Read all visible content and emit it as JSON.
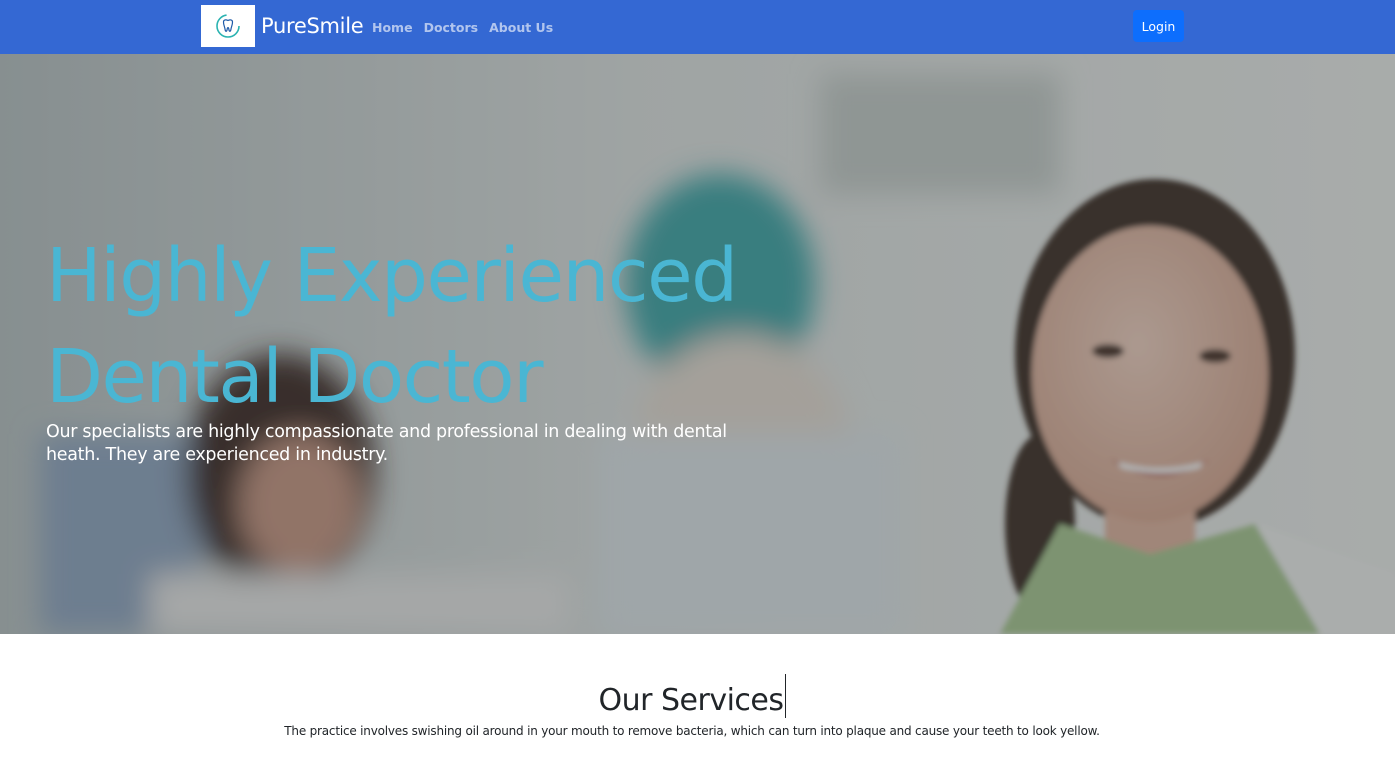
{
  "navbar": {
    "brand_name": "PureSmile",
    "logo_icon": "tooth-logo-icon",
    "links": [
      "Home",
      "Doctors",
      "About Us"
    ],
    "login_label": "Login",
    "background_color": "#3468d3",
    "login_color": "#0d6efd"
  },
  "hero": {
    "title": "Highly Experienced Dental Doctor",
    "subtitle": "Our specialists are highly compassionate and professional in dealing with dental heath. They are experienced in industry.",
    "title_color": "#4ab6d3"
  },
  "services": {
    "title": "Our Services",
    "description": "The practice involves swishing oil around in your mouth to remove bacteria, which can turn into plaque and cause your teeth to look yellow."
  }
}
